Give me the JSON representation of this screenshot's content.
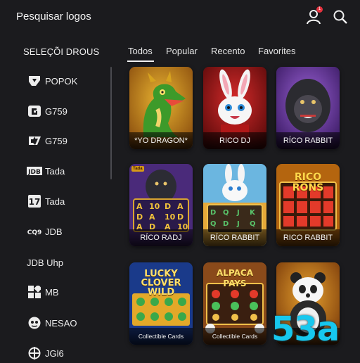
{
  "header": {
    "title": "Pesquisar logos",
    "notification_count": "1"
  },
  "sidebar": {
    "heading": "SELEÇÕI DROUS",
    "items": [
      {
        "label": "POPOK",
        "icon": "popok-logo-icon"
      },
      {
        "label": "G759",
        "icon": "pg-logo-icon"
      },
      {
        "label": "G759",
        "icon": "g7-logo-icon"
      },
      {
        "label": "Tada",
        "icon": "jdb-logo-icon",
        "icon_text": "JDB"
      },
      {
        "label": "Tada",
        "icon": "seventeen-logo-icon",
        "icon_text": "17"
      },
      {
        "label": "JDB",
        "icon": "cq9-logo-icon",
        "icon_text": "CQ9"
      },
      {
        "label": "JDB Uhp",
        "icon": ""
      },
      {
        "label": "MB",
        "icon": "mb-logo-icon"
      },
      {
        "label": "NESAO",
        "icon": "nesao-logo-icon"
      },
      {
        "label": "JGl6",
        "icon": "jg-logo-icon"
      }
    ]
  },
  "tabs": [
    "Todos",
    "Popular",
    "Recento",
    "Favorites"
  ],
  "games": [
    {
      "caption": "*YO DRAGON*",
      "art": "dragon"
    },
    {
      "caption": "RICO DJ",
      "art": "rabbit-red"
    },
    {
      "caption": "RÍCO RABBIT",
      "art": "gorilla-purple"
    },
    {
      "caption": "RÍCO RADJ",
      "art": "gorilla-slots",
      "badge": "Tada"
    },
    {
      "caption": "RÍCO RABBIT",
      "art": "rabbit-slots"
    },
    {
      "caption": "RICO RABBIT",
      "art": "rico-rons",
      "banner": "RICO RONS"
    },
    {
      "caption": "Collectible Cards",
      "art": "lucky-clover",
      "banner": "LUCKY CLOVER WILD"
    },
    {
      "caption": "Collectible Cards",
      "art": "alpaca",
      "banner": "ALPACA PAYS"
    },
    {
      "caption": "",
      "art": "panda"
    }
  ],
  "watermark": "53a",
  "colors": {
    "background": "#1b1b1e",
    "accent": "#17c8ee",
    "badge": "#e5333f"
  }
}
